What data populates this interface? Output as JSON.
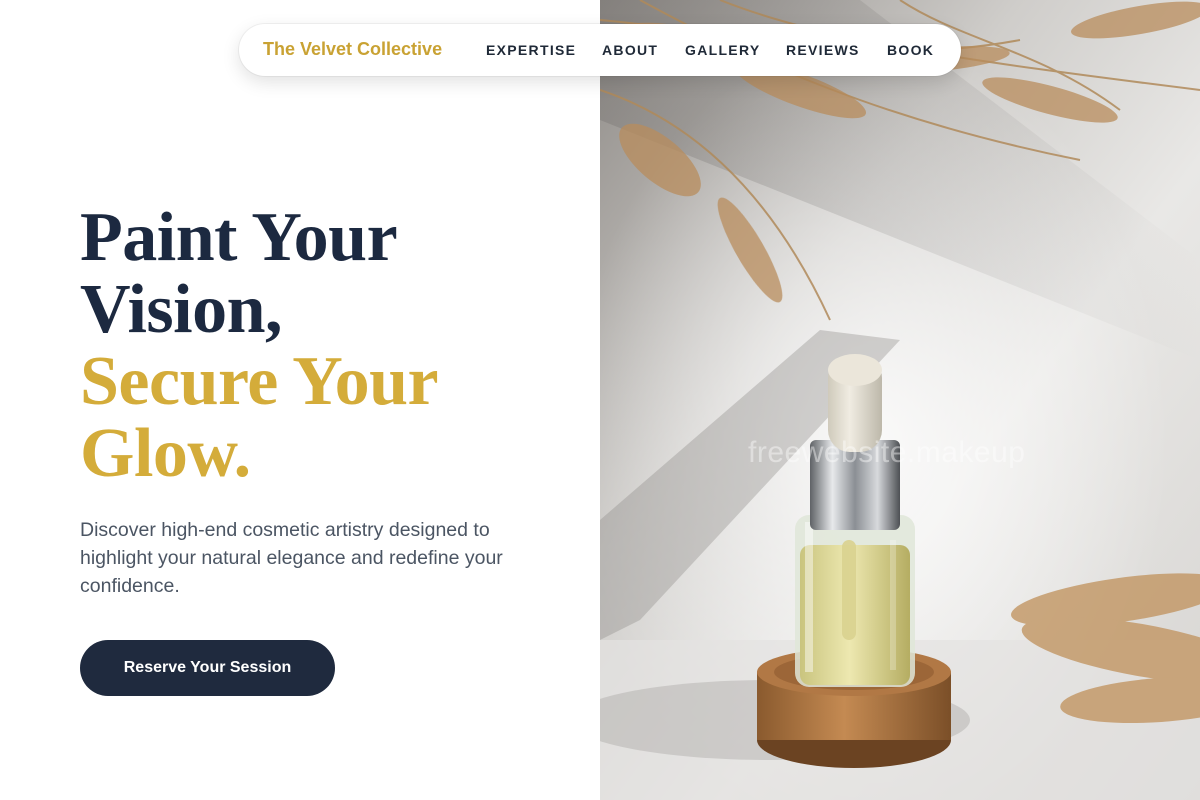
{
  "nav": {
    "brand": "The Velvet Collective",
    "links": [
      {
        "label": "EXPERTISE"
      },
      {
        "label": "ABOUT"
      },
      {
        "label": "GALLERY"
      },
      {
        "label": "REVIEWS"
      },
      {
        "label": "BOOK"
      }
    ]
  },
  "hero": {
    "headline": {
      "line1": "Paint Your",
      "line2": "Vision,",
      "line3": "Secure Your",
      "line4": "Glow."
    },
    "subtitle": "Discover high-end cosmetic artistry designed to highlight your natural elegance and redefine your confidence.",
    "cta_label": "Reserve Your Session"
  },
  "image": {
    "watermark": "freewebsite.makeup",
    "subject": "serum dropper bottle on cork stand with dried pampas grass"
  },
  "colors": {
    "accent_gold": "#d4ac3a",
    "navy": "#1c2940",
    "button_bg": "#1f2a3e"
  }
}
